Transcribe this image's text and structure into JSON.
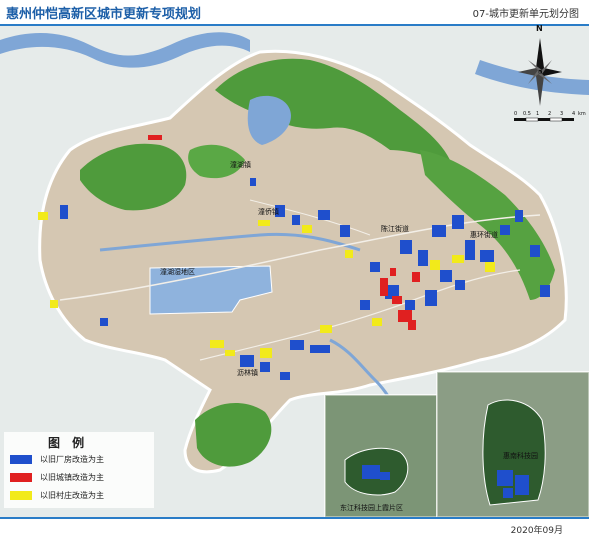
{
  "header": {
    "title": "惠州仲恺高新区城市更新专项规划",
    "subtitle": "07-城市更新单元划分图"
  },
  "footer": {
    "date": "2020年09月"
  },
  "places": {
    "tanhu": "潼湖镇",
    "tanqiao": "潼侨镇",
    "chenjiang": "陈江街道",
    "huihuan": "惠环街道",
    "wetland": "潼湖湿地区",
    "lilin": "沥林镇"
  },
  "legend": {
    "title": "图 例",
    "items": [
      {
        "label": "以旧厂房改造为主",
        "color": "#1f4fcc"
      },
      {
        "label": "以旧城镇改造为主",
        "color": "#e02020"
      },
      {
        "label": "以旧村庄改造为主",
        "color": "#f2ea1a"
      }
    ]
  },
  "compass": {
    "north": "N"
  },
  "scale": {
    "ticks": [
      "0",
      "0.5",
      "1",
      "2",
      "3",
      "4"
    ],
    "unit": "km"
  },
  "insets": {
    "inset1_label": "东江科技园上霞片区",
    "inset2_label": "惠南科技园"
  },
  "colors": {
    "land": "#d5c7b2",
    "mountain": "#4f9b3c",
    "water": "#8fb3dd",
    "river": "#6f96c9",
    "factory": "#1f4fcc",
    "town": "#e02020",
    "village": "#f2ea1a",
    "background": "#e8ecec"
  }
}
